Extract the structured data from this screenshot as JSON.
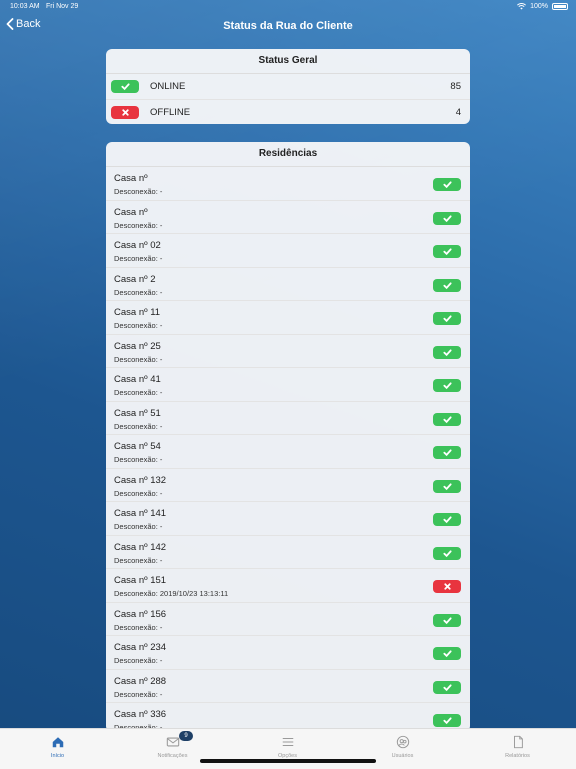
{
  "status_bar": {
    "time": "10:03 AM",
    "date": "Fri Nov 29",
    "battery": "100%"
  },
  "nav": {
    "back_label": "Back",
    "title": "Status da Rua do Cliente"
  },
  "status_geral": {
    "title": "Status Geral",
    "rows": [
      {
        "label": "ONLINE",
        "count": "85",
        "state": "online"
      },
      {
        "label": "OFFLINE",
        "count": "4",
        "state": "offline"
      }
    ]
  },
  "residencias": {
    "title": "Residências",
    "items": [
      {
        "name": "Casa nº",
        "disconnect": "Desconexão: -",
        "state": "online"
      },
      {
        "name": "Casa nº",
        "disconnect": "Desconexão: -",
        "state": "online"
      },
      {
        "name": "Casa nº 02",
        "disconnect": "Desconexão: -",
        "state": "online"
      },
      {
        "name": "Casa nº 2",
        "disconnect": "Desconexão: -",
        "state": "online"
      },
      {
        "name": "Casa nº 11",
        "disconnect": "Desconexão: -",
        "state": "online"
      },
      {
        "name": "Casa nº 25",
        "disconnect": "Desconexão: -",
        "state": "online"
      },
      {
        "name": "Casa nº 41",
        "disconnect": "Desconexão: -",
        "state": "online"
      },
      {
        "name": "Casa nº 51",
        "disconnect": "Desconexão: -",
        "state": "online"
      },
      {
        "name": "Casa nº 54",
        "disconnect": "Desconexão: -",
        "state": "online"
      },
      {
        "name": "Casa nº 132",
        "disconnect": "Desconexão: -",
        "state": "online"
      },
      {
        "name": "Casa nº 141",
        "disconnect": "Desconexão: -",
        "state": "online"
      },
      {
        "name": "Casa nº 142",
        "disconnect": "Desconexão: -",
        "state": "online"
      },
      {
        "name": "Casa nº 151",
        "disconnect": "Desconexão: 2019/10/23 13:13:11",
        "state": "offline"
      },
      {
        "name": "Casa nº 156",
        "disconnect": "Desconexão: -",
        "state": "online"
      },
      {
        "name": "Casa nº 234",
        "disconnect": "Desconexão: -",
        "state": "online"
      },
      {
        "name": "Casa nº 288",
        "disconnect": "Desconexão: -",
        "state": "online"
      },
      {
        "name": "Casa nº 336",
        "disconnect": "Desconexão: -",
        "state": "online"
      }
    ]
  },
  "tabbar": {
    "tabs": [
      {
        "label": "Início",
        "icon": "home-icon",
        "active": true
      },
      {
        "label": "Notificações",
        "icon": "mail-icon",
        "badge": "9"
      },
      {
        "label": "Opções",
        "icon": "menu-icon"
      },
      {
        "label": "Usuários",
        "icon": "users-icon"
      },
      {
        "label": "Relatórios",
        "icon": "document-icon"
      }
    ]
  },
  "colors": {
    "online": "#3cc25a",
    "offline": "#e8343f",
    "accent": "#2d6cb5"
  }
}
